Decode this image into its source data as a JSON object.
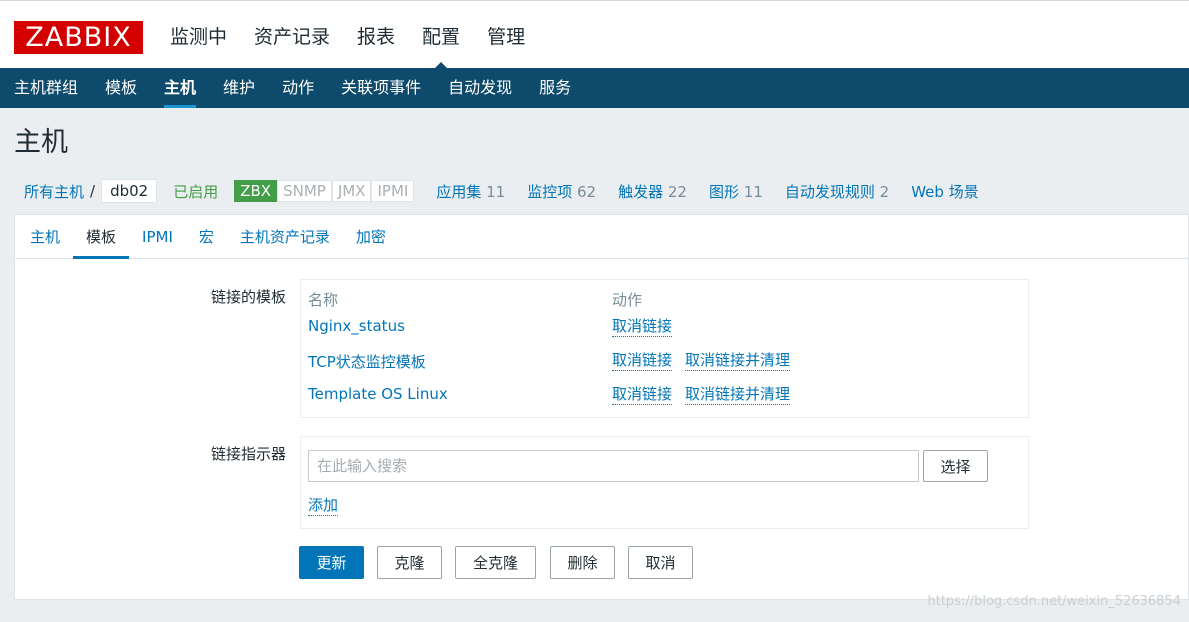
{
  "logo": "ZABBIX",
  "main_menu": [
    "监测中",
    "资产记录",
    "报表",
    "配置",
    "管理"
  ],
  "sub_menu": [
    "主机群组",
    "模板",
    "主机",
    "维护",
    "动作",
    "关联项事件",
    "自动发现",
    "服务"
  ],
  "page_title": "主机",
  "breadcrumb": {
    "all_hosts": "所有主机",
    "separator": "/",
    "current": "db02",
    "status": "已启用",
    "badges": [
      "ZBX",
      "SNMP",
      "JMX",
      "IPMI"
    ],
    "counts": [
      {
        "label": "应用集",
        "value": "11"
      },
      {
        "label": "监控项",
        "value": "62"
      },
      {
        "label": "触发器",
        "value": "22"
      },
      {
        "label": "图形",
        "value": "11"
      },
      {
        "label": "自动发现规则",
        "value": "2"
      },
      {
        "label": "Web 场景",
        "value": ""
      }
    ]
  },
  "tabs": [
    "主机",
    "模板",
    "IPMI",
    "宏",
    "主机资产记录",
    "加密"
  ],
  "linked_templates": {
    "label": "链接的模板",
    "col_name": "名称",
    "col_action": "动作",
    "rows": [
      {
        "name": "Nginx_status",
        "unlink": "取消链接",
        "unlink_clear": ""
      },
      {
        "name": "TCP状态监控模板",
        "unlink": "取消链接",
        "unlink_clear": "取消链接并清理"
      },
      {
        "name": "Template OS Linux",
        "unlink": "取消链接",
        "unlink_clear": "取消链接并清理"
      }
    ]
  },
  "link_indicator": {
    "label": "链接指示器",
    "placeholder": "在此输入搜索",
    "select_button": "选择",
    "add_link": "添加"
  },
  "buttons": {
    "update": "更新",
    "clone": "克隆",
    "full_clone": "全克隆",
    "delete": "删除",
    "cancel": "取消"
  },
  "watermark": "https://blog.csdn.net/weixin_52636854"
}
